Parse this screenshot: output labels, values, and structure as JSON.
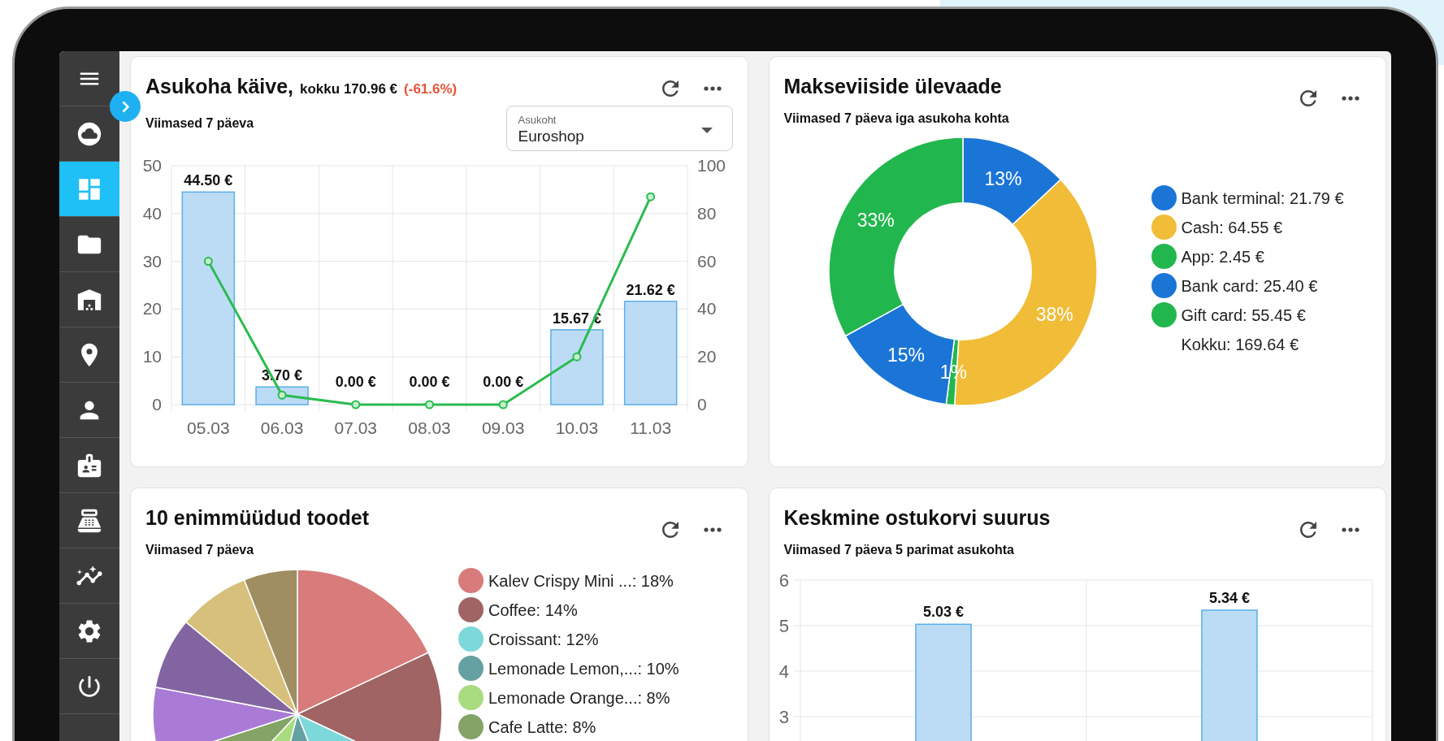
{
  "sidebar": {
    "items": [
      {
        "selected": false
      },
      {
        "selected": true
      },
      {
        "selected": false
      },
      {
        "selected": false
      },
      {
        "selected": false
      },
      {
        "selected": false
      },
      {
        "selected": false
      },
      {
        "selected": false
      },
      {
        "selected": false
      },
      {
        "selected": false
      },
      {
        "selected": false
      }
    ]
  },
  "cards": [
    {
      "title": "Asukoha käive,",
      "total": "kokku 170.96 €",
      "change": "(-61.6%)",
      "subtitle": "Viimased 7 päeva",
      "select": {
        "label": "Asukoht",
        "value": "Euroshop"
      },
      "chart_data": {
        "type": "bar",
        "categories": [
          "05.03",
          "06.03",
          "07.03",
          "08.03",
          "09.03",
          "10.03",
          "11.03"
        ],
        "series": [
          {
            "type": "bar",
            "color": "#bcdcf5",
            "values": [
              44.5,
              3.7,
              0,
              0,
              0,
              15.67,
              21.62
            ],
            "value_labels": [
              "44.50 €",
              "3.70 €",
              "0.00 €",
              "0.00 €",
              "0.00 €",
              "15.67 €",
              "21.62 €"
            ]
          },
          {
            "type": "line",
            "marker": true,
            "color": "#2bbb4f",
            "values": [
              30,
              2,
              0,
              0,
              0,
              10,
              43.5
            ]
          }
        ],
        "grid": true,
        "ylim": [
          0,
          50
        ],
        "yticks": [
          0,
          10,
          20,
          30,
          40,
          50
        ]
      },
      "right_axis_ticks": [
        "100",
        "80",
        "60",
        "40",
        "20",
        "0"
      ]
    },
    {
      "title": "Makseviiside ülevaade",
      "subtitle": "Viimased 7 päeva iga asukoha kohta",
      "chart_data": {
        "type": "donut",
        "series": [
          {
            "values": [
              13,
              38,
              1,
              15,
              33
            ],
            "colors": [
              "#1b75d6",
              "#f1bd38",
              "#22b74e",
              "#1b75d6",
              "#22b74e"
            ],
            "value_labels": [
              "13%",
              "38%",
              "1%",
              "15%",
              "33%"
            ]
          }
        ]
      },
      "legend": [
        "Bank terminal: 21.79 €",
        "Cash: 64.55 €",
        "App: 2.45 €",
        "Bank card: 25.40 €",
        "Gift card: 55.45 €"
      ],
      "legend_total": "Kokku: 169.64 €"
    },
    {
      "title": "10 enimmüüdud toodet",
      "subtitle": "Viimased 7 päeva",
      "chart_data": {
        "type": "pie",
        "series": [
          {
            "values": [
              18,
              14,
              12,
              10,
              8,
              8,
              8,
              8,
              8,
              6
            ],
            "colors": [
              "#d87b7b",
              "#a06464",
              "#7dd8da",
              "#65a1a2",
              "#a9db7f",
              "#84a367",
              "#a97bd6",
              "#8265a0",
              "#d7c07b",
              "#a08e63"
            ]
          }
        ]
      },
      "legend": [
        "Kalev Crispy Mini ...: 18%",
        "Coffee: 14%",
        "Croissant: 12%",
        "Lemonade Lemon,...: 10%",
        "Lemonade Orange...: 8%",
        "Cafe Latte: 8%"
      ]
    },
    {
      "title": "Keskmine ostukorvi suurus",
      "subtitle": "Viimased 7 päeva 5 parimat asukohta",
      "chart_data": {
        "type": "bar",
        "series": [
          {
            "color": "#bcdcf5",
            "values": [
              5.03,
              5.34
            ],
            "value_labels": [
              "5.03 €",
              "5.34 €"
            ]
          }
        ],
        "grid": true,
        "ylim": [
          0,
          6
        ],
        "yticks": [
          3,
          4,
          5,
          6
        ]
      }
    }
  ]
}
